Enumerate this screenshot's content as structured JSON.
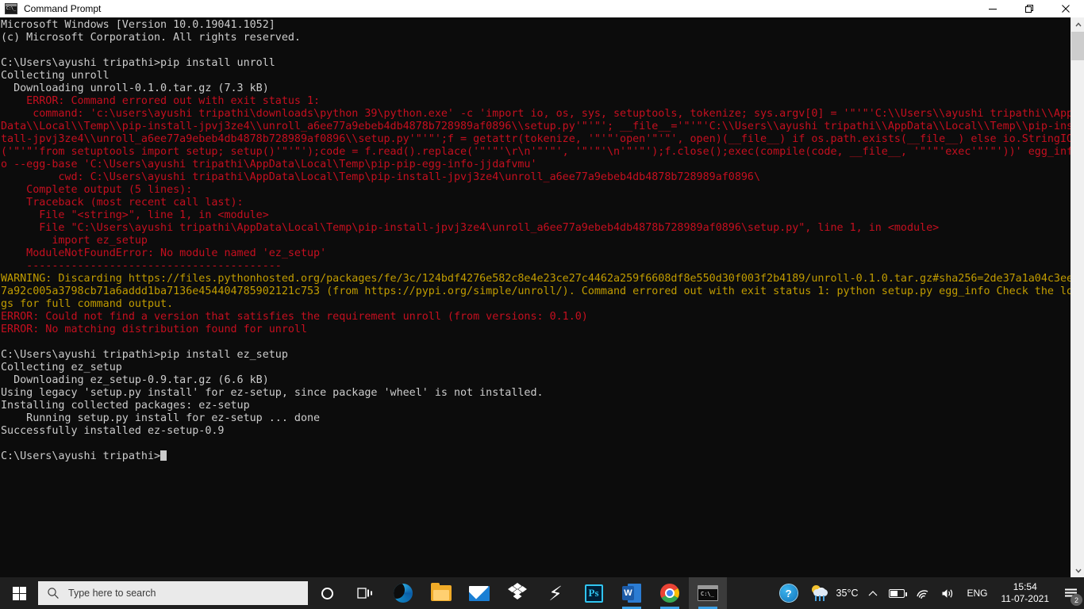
{
  "window": {
    "title": "Command Prompt",
    "icon": "cmd-icon",
    "controls": {
      "minimize": "minimize-button",
      "maximize": "maximize-button",
      "close": "close-button"
    }
  },
  "console": {
    "prompt_user_path": "C:\\Users\\ayushi tripathi>",
    "colors": {
      "background": "#0c0c0c",
      "text": "#cccccc",
      "error": "#c50f1f",
      "warning": "#c19c00"
    },
    "lines": [
      {
        "color": "white",
        "text": "Microsoft Windows [Version 10.0.19041.1052]"
      },
      {
        "color": "white",
        "text": "(c) Microsoft Corporation. All rights reserved."
      },
      {
        "color": "white",
        "text": ""
      },
      {
        "color": "white",
        "text": "C:\\Users\\ayushi tripathi>pip install unroll"
      },
      {
        "color": "white",
        "text": "Collecting unroll"
      },
      {
        "color": "white",
        "text": "  Downloading unroll-0.1.0.tar.gz (7.3 kB)"
      },
      {
        "color": "red",
        "text": "    ERROR: Command errored out with exit status 1:"
      },
      {
        "color": "red",
        "text": "     command: 'c:\\users\\ayushi tripathi\\downloads\\python 39\\python.exe' -c 'import io, os, sys, setuptools, tokenize; sys.argv[0] = '\"'\"'C:\\\\Users\\\\ayushi tripathi\\\\App"
      },
      {
        "color": "red",
        "text": "Data\\\\Local\\\\Temp\\\\pip-install-jpvj3ze4\\\\unroll_a6ee77a9ebeb4db4878b728989af0896\\\\setup.py'\"'\"'; __file__='\"'\"'C:\\\\Users\\\\ayushi tripathi\\\\AppData\\\\Local\\\\Temp\\\\pip-ins"
      },
      {
        "color": "red",
        "text": "tall-jpvj3ze4\\\\unroll_a6ee77a9ebeb4db4878b728989af0896\\\\setup.py'\"'\"';f = getattr(tokenize, '\"'\"'open'\"'\"', open)(__file__) if os.path.exists(__file__) else io.StringIO"
      },
      {
        "color": "red",
        "text": "('\"'\"'from setuptools import setup; setup()'\"'\"');code = f.read().replace('\"'\"'\\r\\n'\"'\"', '\"'\"'\\n'\"'\"');f.close();exec(compile(code, __file__, '\"'\"'exec'\"'\"'))' egg_inf"
      },
      {
        "color": "red",
        "text": "o --egg-base 'C:\\Users\\ayushi tripathi\\AppData\\Local\\Temp\\pip-pip-egg-info-jjdafvmu'"
      },
      {
        "color": "red",
        "text": "         cwd: C:\\Users\\ayushi tripathi\\AppData\\Local\\Temp\\pip-install-jpvj3ze4\\unroll_a6ee77a9ebeb4db4878b728989af0896\\"
      },
      {
        "color": "red",
        "text": "    Complete output (5 lines):"
      },
      {
        "color": "red",
        "text": "    Traceback (most recent call last):"
      },
      {
        "color": "red",
        "text": "      File \"<string>\", line 1, in <module>"
      },
      {
        "color": "red",
        "text": "      File \"C:\\Users\\ayushi tripathi\\AppData\\Local\\Temp\\pip-install-jpvj3ze4\\unroll_a6ee77a9ebeb4db4878b728989af0896\\setup.py\", line 1, in <module>"
      },
      {
        "color": "red",
        "text": "        import ez_setup"
      },
      {
        "color": "red",
        "text": "    ModuleNotFoundError: No module named 'ez_setup'"
      },
      {
        "color": "red",
        "text": "    ----------------------------------------"
      },
      {
        "color": "yellow",
        "text": "WARNING: Discarding https://files.pythonhosted.org/packages/fe/3c/124bdf4276e582c8e4e23ce27c4462a259f6608df8e550d30f003f2b4189/unroll-0.1.0.tar.gz#sha256=2de37a1a04c3ee"
      },
      {
        "color": "yellow",
        "text": "7a92c005a3798cb71a6addd1ba7136e454404785902121c753 (from https://pypi.org/simple/unroll/). Command errored out with exit status 1: python setup.py egg_info Check the lo"
      },
      {
        "color": "yellow",
        "text": "gs for full command output."
      },
      {
        "color": "red",
        "text": "ERROR: Could not find a version that satisfies the requirement unroll (from versions: 0.1.0)"
      },
      {
        "color": "red",
        "text": "ERROR: No matching distribution found for unroll"
      },
      {
        "color": "white",
        "text": ""
      },
      {
        "color": "white",
        "text": "C:\\Users\\ayushi tripathi>pip install ez_setup"
      },
      {
        "color": "white",
        "text": "Collecting ez_setup"
      },
      {
        "color": "white",
        "text": "  Downloading ez_setup-0.9.tar.gz (6.6 kB)"
      },
      {
        "color": "white",
        "text": "Using legacy 'setup.py install' for ez-setup, since package 'wheel' is not installed."
      },
      {
        "color": "white",
        "text": "Installing collected packages: ez-setup"
      },
      {
        "color": "white",
        "text": "    Running setup.py install for ez-setup ... done"
      },
      {
        "color": "white",
        "text": "Successfully installed ez-setup-0.9"
      },
      {
        "color": "white",
        "text": ""
      }
    ],
    "final_prompt": "C:\\Users\\ayushi tripathi>"
  },
  "scrollbar": {
    "up_arrow": "scroll-up-arrow",
    "down_arrow": "scroll-down-arrow"
  },
  "taskbar": {
    "start": "start-button",
    "search": {
      "placeholder": "Type here to search",
      "icon": "search-icon"
    },
    "cortana": "cortana-icon",
    "task_view": "task-view-icon",
    "items": [
      {
        "name": "edge",
        "label": "Microsoft Edge",
        "running": false,
        "active": false
      },
      {
        "name": "explorer",
        "label": "File Explorer",
        "running": false,
        "active": false
      },
      {
        "name": "mail",
        "label": "Mail",
        "running": false,
        "active": false
      },
      {
        "name": "dropbox",
        "label": "Dropbox",
        "running": false,
        "active": false
      },
      {
        "name": "bolt",
        "label": "Lightning App",
        "running": false,
        "active": false
      },
      {
        "name": "photoshop",
        "label": "Adobe Photoshop",
        "running": false,
        "active": false
      },
      {
        "name": "word",
        "label": "Microsoft Word",
        "running": true,
        "active": false
      },
      {
        "name": "chrome",
        "label": "Google Chrome",
        "running": true,
        "active": false
      },
      {
        "name": "cmd",
        "label": "Command Prompt",
        "running": true,
        "active": true
      }
    ],
    "tray": {
      "help": "?",
      "weather_temp": "35°C",
      "weather_icon": "sun-cloud-rain-icon",
      "show_hidden": "˄",
      "battery": "battery-icon",
      "network": "wifi-icon",
      "volume": "volume-icon",
      "language": "ENG",
      "time": "15:54",
      "date": "11-07-2021",
      "notifications_count": "2"
    }
  }
}
